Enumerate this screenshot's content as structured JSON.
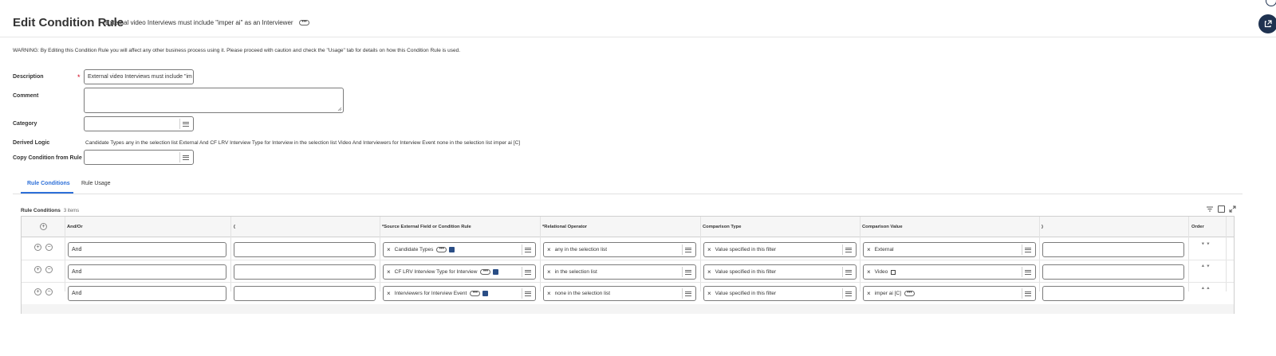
{
  "header": {
    "title": "Edit Condition Rule",
    "subtitle": "External video Interviews must include \"imper ai\" as an Interviewer",
    "more_label": "•••"
  },
  "warning": "WARNING: By Editing this Condition Rule you will affect any other business process using it. Please proceed with caution and check the \"Usage\" tab for details on how this Condition Rule is used.",
  "form": {
    "description_label": "Description",
    "description_required": "*",
    "description_value": "External video Interviews must include \"im",
    "comment_label": "Comment",
    "comment_value": "",
    "category_label": "Category",
    "category_value": "",
    "derived_logic_label": "Derived Logic",
    "derived_logic_value": "Candidate Types any in the selection list External And CF LRV Interview Type for Interview in the selection list Video And Interviewers for Interview Event none in the selection list imper ai [C]",
    "copy_label": "Copy Condition from Rule",
    "copy_value": ""
  },
  "tabs": [
    {
      "label": "Rule Conditions",
      "active": true
    },
    {
      "label": "Rule Usage",
      "active": false
    }
  ],
  "grid": {
    "title": "Rule Conditions",
    "count": "3 items",
    "add_symbol": "+",
    "remove_symbol": "−",
    "columns": [
      "And/Or",
      "(",
      "*Source External Field or Condition Rule",
      "*Relational Operator",
      "Comparison Type",
      "Comparison Value",
      ")",
      "Order"
    ],
    "rows": [
      {
        "and_or": "And",
        "open_paren": "",
        "source": "Candidate Types",
        "operator": "any in the selection list",
        "comparison_type": "Value specified in this filter",
        "comparison_value": "External",
        "close_paren": "",
        "order": "⯆ ⯆"
      },
      {
        "and_or": "And",
        "open_paren": "",
        "source": "CF LRV Interview Type for Interview",
        "operator": "in the selection list",
        "comparison_type": "Value specified in this filter",
        "comparison_value": "Video",
        "close_paren": "",
        "order": "⯅ ⯆"
      },
      {
        "and_or": "And",
        "open_paren": "",
        "source": "Interviewers for Interview Event",
        "operator": "none in the selection list",
        "comparison_type": "Value specified in this filter",
        "comparison_value": "imper ai [C]",
        "close_paren": "",
        "order": "⯅ ⯅"
      }
    ],
    "chip_remove": "×"
  },
  "colors": {
    "accent": "#2d6fd8",
    "fab": "#1f3250",
    "required": "#d0021b"
  }
}
